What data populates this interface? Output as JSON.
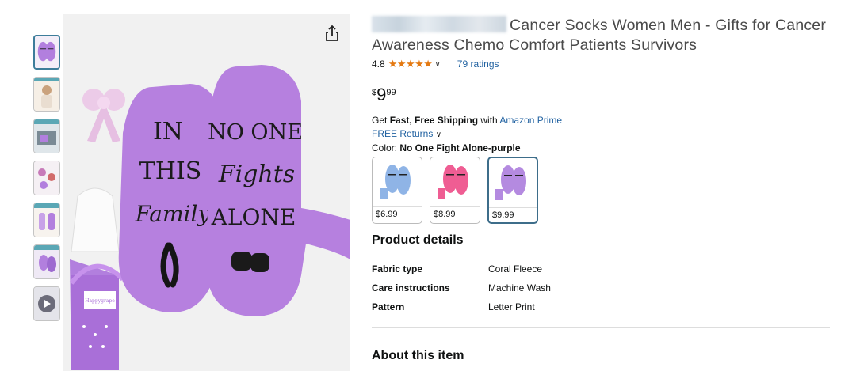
{
  "product": {
    "title": "Cancer Socks Women Men - Gifts for Cancer Awareness Chemo Comfort Patients Survivors",
    "rating": "4.8",
    "stars": "★★★★★",
    "ratings_count": "79 ratings",
    "price": {
      "symbol": "$",
      "whole": "9",
      "fraction": "99"
    }
  },
  "shipping": {
    "prefix": "Get ",
    "fast_label": "Fast, Free Shipping",
    "middle": " with ",
    "prime_link": "Amazon Prime",
    "returns_link": "FREE Returns"
  },
  "color": {
    "label": "Color: ",
    "selected": "No One Fight Alone-purple",
    "options": [
      {
        "price": "$6.99",
        "color": "#8fb4e6"
      },
      {
        "price": "$8.99",
        "color": "#ef5d93"
      },
      {
        "price": "$9.99",
        "color": "#b48ae0"
      }
    ]
  },
  "product_details": {
    "heading": "Product details",
    "rows": [
      {
        "key": "Fabric type",
        "value": "Coral Fleece"
      },
      {
        "key": "Care instructions",
        "value": "Machine Wash"
      },
      {
        "key": "Pattern",
        "value": "Letter Print"
      }
    ]
  },
  "about": {
    "heading": "About this item"
  },
  "main_image": {
    "left_sock_text": [
      "IN",
      "THIS",
      "Family"
    ],
    "right_sock_text": [
      "NO ONE",
      "Fights",
      "ALONE"
    ],
    "box_label": "Happygrape"
  },
  "colors": {
    "accent_orange": "#e47911",
    "link_blue": "#2162a1",
    "sock_purple": "#b27fde"
  },
  "icons": {
    "share": "share-icon",
    "chevron": "chevron-down-icon",
    "star": "star-icon"
  }
}
